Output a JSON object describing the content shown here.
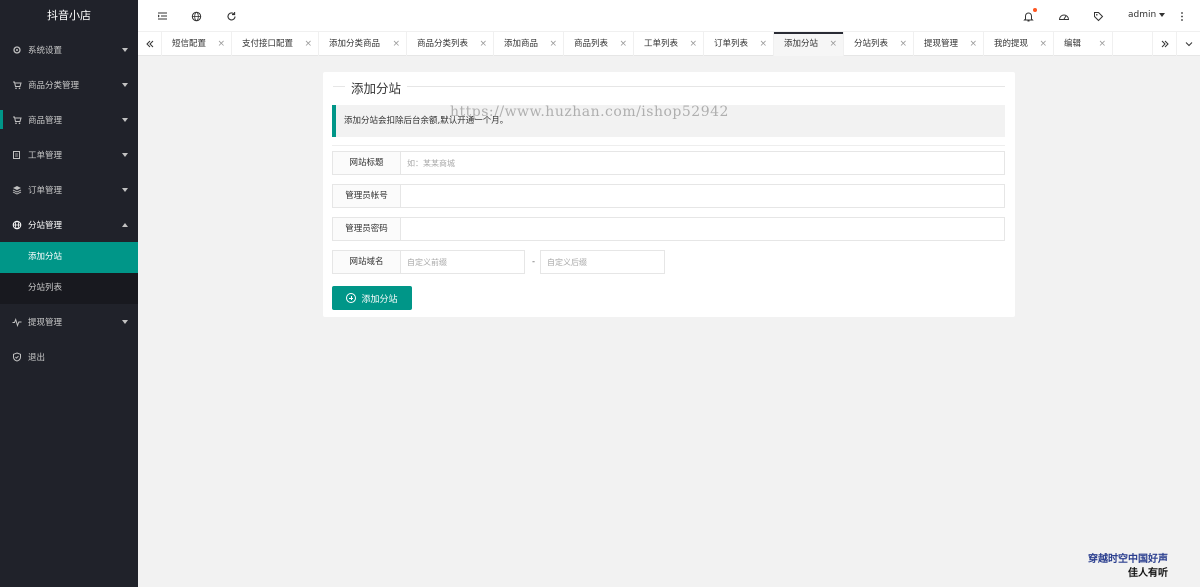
{
  "app": {
    "title": "抖音小店"
  },
  "sidebar": {
    "items": [
      {
        "label": "系统设置",
        "icon": "gear-icon"
      },
      {
        "label": "商品分类管理",
        "icon": "cart-icon"
      },
      {
        "label": "商品管理",
        "icon": "cart-icon"
      },
      {
        "label": "工单管理",
        "icon": "ticket-icon"
      },
      {
        "label": "订单管理",
        "icon": "layers-icon"
      },
      {
        "label": "分站管理",
        "icon": "globe-icon"
      },
      {
        "label": "提现管理",
        "icon": "pulse-icon"
      },
      {
        "label": "退出",
        "icon": "shield-icon"
      }
    ],
    "sub_items": [
      {
        "label": "添加分站"
      },
      {
        "label": "分站列表"
      }
    ]
  },
  "header": {
    "user": "admin",
    "icons": [
      "menu-fold-icon",
      "globe-icon",
      "refresh-icon",
      "bell-icon",
      "dashboard-icon",
      "tag-icon",
      "more-icon"
    ]
  },
  "tabs": [
    {
      "label": "短信配置"
    },
    {
      "label": "支付接口配置"
    },
    {
      "label": "添加分类商品"
    },
    {
      "label": "商品分类列表"
    },
    {
      "label": "添加商品"
    },
    {
      "label": "商品列表"
    },
    {
      "label": "工单列表"
    },
    {
      "label": "订单列表"
    },
    {
      "label": "添加分站"
    },
    {
      "label": "分站列表"
    },
    {
      "label": "提现管理"
    },
    {
      "label": "我的提现"
    },
    {
      "label": "编辑"
    }
  ],
  "form": {
    "legend": "添加分站",
    "notice": "添加分站会扣除后台余额,默认开通一个月。",
    "site_title_label": "网站标题",
    "site_title_placeholder": "如：某某商城",
    "admin_account_label": "管理员帐号",
    "admin_password_label": "管理员密码",
    "domain_label": "网站域名",
    "domain_prefix_placeholder": "自定义前缀",
    "domain_separator": "-",
    "domain_suffix_placeholder": "自定义后缀",
    "submit_label": "添加分站"
  },
  "watermark": "https://www.huzhan.com/ishop52942",
  "corner_text": {
    "line1": "穿越时空中国好声",
    "line2": "佳人有听"
  },
  "colors": {
    "accent": "#009688",
    "sidebar_bg": "#20222a",
    "badge": "#ff5722"
  }
}
